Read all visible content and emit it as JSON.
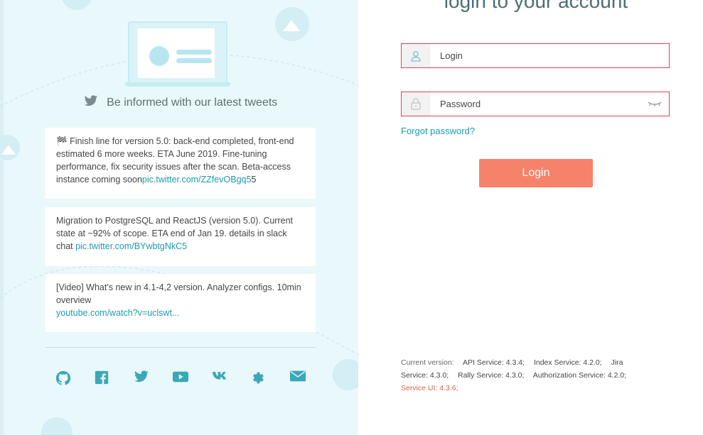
{
  "left_panel": {
    "tweets_header": "Be informed with our latest tweets",
    "tweets": [
      {
        "flag": "🏁",
        "text": "Finish line for version 5.0: back-end completed, front-end estimated 6 more weeks. ETA June 2019. Fine-tuning performance, fix security issues after the scan. Beta-access instance coming soon",
        "link": "pic.twitter.com/ZZfevOBgq5",
        "suffix": "5"
      },
      {
        "text": "Migration to PostgreSQL and ReactJS (version 5.0). Current state at ~92% of scope. ETA end of Jan 19. details in slack chat ",
        "link": "pic.twitter.com/BYwbtgNkC5"
      },
      {
        "text": "[Video] What's new in 4.1-4,2 version. Analyzer configs. 10min overview",
        "link": "youtube.com/watch?v=uclswt..."
      }
    ],
    "social_icons": [
      "github-icon",
      "facebook-icon",
      "twitter-icon",
      "youtube-icon",
      "vk-icon",
      "gear-icon",
      "email-icon"
    ]
  },
  "login_form": {
    "title": "login to your account",
    "login_placeholder": "Login",
    "password_placeholder": "Password",
    "forgot_password": "Forgot password?",
    "login_button": "Login"
  },
  "versions": {
    "label": "Current version:",
    "api": "API Service: 4.3.4;",
    "index": "Index Service: 4.2.0;",
    "jira": "Jira Service: 4.3.0;",
    "rally": "Rally Service: 4.3.0;",
    "auth": "Authorization Service: 4.2.0;",
    "ui": "Service UI: 4.3.6;"
  },
  "colors": {
    "left_bg": "#e9f8fb",
    "accent": "#1a9cb0",
    "error_border": "#e0434c",
    "button": "#f7826a",
    "ui_version": "#d2664d"
  }
}
